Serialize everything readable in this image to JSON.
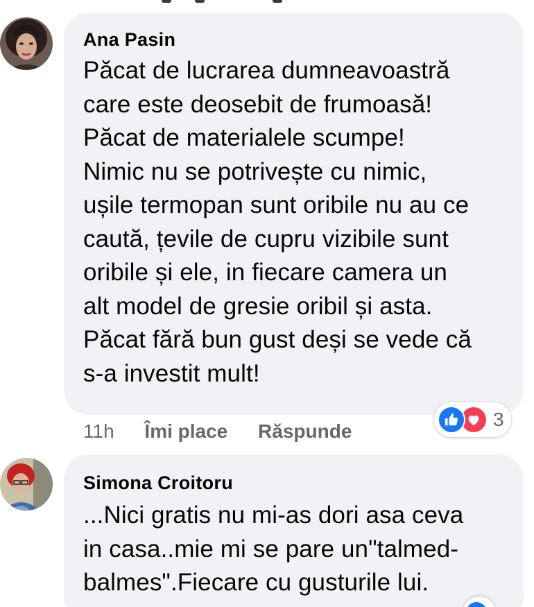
{
  "colors": {
    "bubble_bg": "#f0f2f5",
    "text": "#050505",
    "meta": "#65676b",
    "like_blue": "#1877f2",
    "love_red": "#f33e58"
  },
  "comments": [
    {
      "author": "Ana Pasin",
      "avatar_icon": "profile-photo",
      "text": "Păcat de lucrarea dumneavoastră\ncare este deosebit de frumoasă!\nPăcat de materialele scumpe!\nNimic nu se potrivește cu nimic,\nușile termopan sunt oribile nu au ce\ncaută, țevile de cupru vizibile sunt\noribile și ele, in fiecare camera un\nalt model de gresie oribil și asta.\nPăcat fără bun gust deși se vede că\ns-a investit mult!",
      "time": "11h",
      "like_label": "Îmi place",
      "reply_label": "Răspunde",
      "reactions": {
        "icons": [
          "like-icon",
          "love-icon"
        ],
        "count": "3"
      }
    },
    {
      "author": "Simona Croitoru",
      "avatar_icon": "profile-photo",
      "text": "...Nici gratis nu mi-as dori asa ceva\nin casa..mie mi se pare un\"talmed-\nbalmes\".Fiecare cu gusturile lui."
    }
  ]
}
